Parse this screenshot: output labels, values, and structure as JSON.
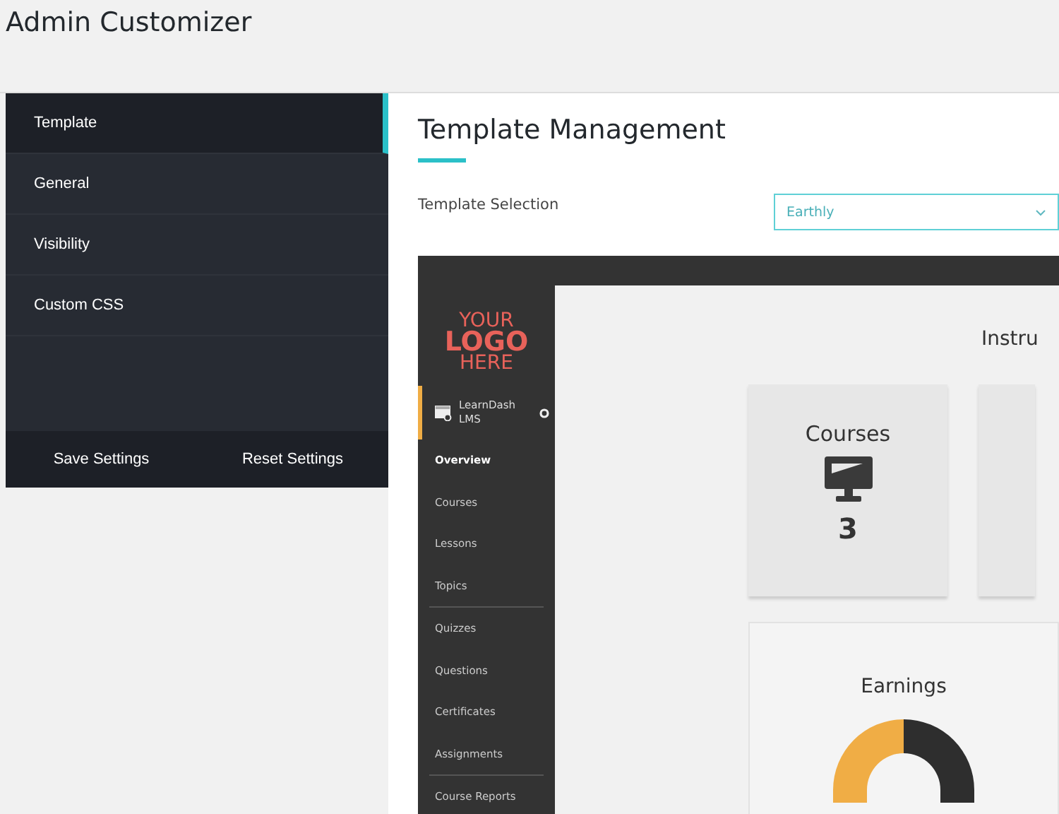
{
  "page_title": "Admin Customizer",
  "tabs": [
    {
      "label": "Template",
      "selected": true
    },
    {
      "label": "General",
      "selected": false
    },
    {
      "label": "Visibility",
      "selected": false
    },
    {
      "label": "Custom CSS",
      "selected": false
    }
  ],
  "footer_buttons": [
    "Save Settings",
    "Reset Settings"
  ],
  "panel": {
    "title": "Template Management",
    "field_label": "Template Selection",
    "select_value": "Earthly"
  },
  "preview": {
    "logo": [
      "YOUR",
      "LOGO",
      "HERE"
    ],
    "brand": "LearnDash LMS",
    "nav_groups": [
      [
        {
          "label": "Overview",
          "selected": true
        },
        {
          "label": "Courses",
          "selected": false
        },
        {
          "label": "Lessons",
          "selected": false
        },
        {
          "label": "Topics",
          "selected": false
        }
      ],
      [
        {
          "label": "Quizzes",
          "selected": false
        },
        {
          "label": "Questions",
          "selected": false
        },
        {
          "label": "Certificates",
          "selected": false
        },
        {
          "label": "Assignments",
          "selected": false
        }
      ],
      [
        {
          "label": "Course Reports",
          "selected": false
        }
      ]
    ],
    "heading": "Instru",
    "stat_title": "Courses",
    "stat_value": "3",
    "earnings_title": "Earnings"
  }
}
